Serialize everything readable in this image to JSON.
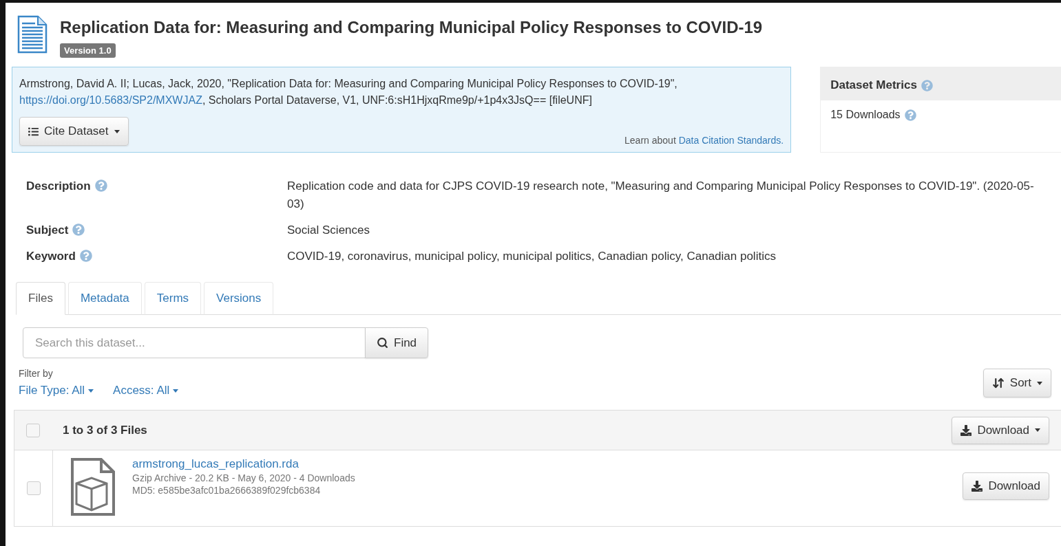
{
  "header": {
    "title": "Replication Data for: Measuring and Comparing Municipal Policy Responses to COVID-19",
    "version_badge": "Version 1.0"
  },
  "citation": {
    "text_before": "Armstrong, David A. II; Lucas, Jack, 2020, \"Replication Data for: Measuring and Comparing Municipal Policy Responses to COVID-19\", ",
    "link": "https://doi.org/10.5683/SP2/MXWJAZ",
    "text_after": ", Scholars Portal Dataverse, V1, UNF:6:sH1HjxqRme9p/+1p4x3JsQ== [fileUNF]",
    "cite_button": "Cite Dataset",
    "learn_text": "Learn about",
    "learn_link": "Data Citation Standards."
  },
  "metrics": {
    "title": "Dataset Metrics",
    "downloads": "15 Downloads"
  },
  "fields": [
    {
      "label": "Description",
      "value": "Replication code and data for CJPS COVID-19 research note, \"Measuring and Comparing Municipal Policy Responses to COVID-19\". (2020-05-03)"
    },
    {
      "label": "Subject",
      "value": "Social Sciences"
    },
    {
      "label": "Keyword",
      "value": "COVID-19, coronavirus, municipal policy, municipal politics, Canadian policy, Canadian politics"
    }
  ],
  "tabs": [
    {
      "label": "Files",
      "selected": true
    },
    {
      "label": "Metadata",
      "selected": false
    },
    {
      "label": "Terms",
      "selected": false
    },
    {
      "label": "Versions",
      "selected": false
    }
  ],
  "search": {
    "placeholder": "Search this dataset...",
    "button": "Find"
  },
  "filter": {
    "label": "Filter by",
    "options": [
      {
        "label": "File Type: All"
      },
      {
        "label": "Access: All"
      }
    ]
  },
  "sort_button": "Sort",
  "files": {
    "count": "1 to 3 of 3 Files",
    "select_all_checked": false,
    "download_button": "Download",
    "rows": [
      {
        "name": "armstrong_lucas_replication.rda",
        "details": "Gzip Archive - 20.2 KB - May 6, 2020 - 4 Downloads",
        "md5": "MD5: e585be3afc01ba2666389f029fcb6384",
        "checked": false,
        "button": "Download"
      }
    ]
  }
}
